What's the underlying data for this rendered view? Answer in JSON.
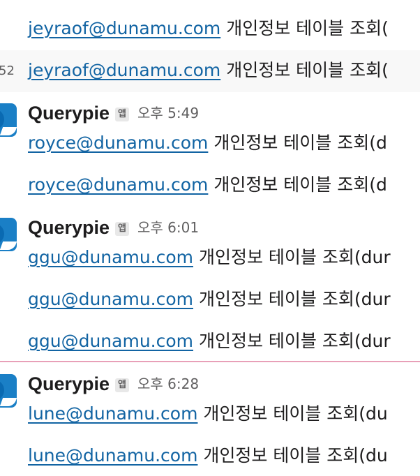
{
  "top_rows": [
    {
      "email": "jeyraof@dunamu.com",
      "text": "개인정보 테이블 조회("
    },
    {
      "timestamp": "52",
      "email": "jeyraof@dunamu.com",
      "text": "개인정보 테이블 조회("
    }
  ],
  "groups": [
    {
      "sender": "Querypie",
      "badge": "앱",
      "time": "오후 5:49",
      "messages": [
        {
          "email": "royce@dunamu.com",
          "text": "개인정보 테이블 조회(d"
        },
        {
          "email": "royce@dunamu.com",
          "text": "개인정보 테이블 조회(d"
        }
      ]
    },
    {
      "sender": "Querypie",
      "badge": "앱",
      "time": "오후 6:01",
      "messages": [
        {
          "email": "ggu@dunamu.com",
          "text": "개인정보 테이블 조회(dur"
        },
        {
          "email": "ggu@dunamu.com",
          "text": "개인정보 테이블 조회(dur"
        },
        {
          "email": "ggu@dunamu.com",
          "text": "개인정보 테이블 조회(dur"
        }
      ]
    },
    {
      "sender": "Querypie",
      "badge": "앱",
      "time": "오후 6:28",
      "messages": [
        {
          "email": "lune@dunamu.com",
          "text": "개인정보 테이블 조회(du"
        },
        {
          "email": "lune@dunamu.com",
          "text": "개인정보 테이블 조회(du"
        }
      ]
    }
  ],
  "colors": {
    "link": "#1264a3",
    "new_divider": "#e8a0b8",
    "avatar": "#1a7fc6"
  }
}
